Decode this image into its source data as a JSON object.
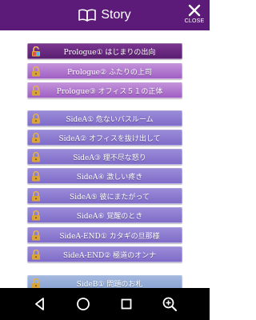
{
  "header": {
    "title": "Story",
    "close_label": "CLOSE",
    "background": "#5c1b78",
    "icons": {
      "title": "open-book-icon",
      "close": "close-icon"
    }
  },
  "chapters": [
    {
      "label": "Prologue① はじまりの出向",
      "group": "prologue",
      "state": "current",
      "icon": "unlocked-padlock-icon"
    },
    {
      "label": "Prologue② ふたりの上司",
      "group": "prologue",
      "state": "locked",
      "icon": "padlock-icon"
    },
    {
      "label": "Prologue③ オフィス５１の正体",
      "group": "prologue",
      "state": "locked",
      "icon": "padlock-icon"
    },
    {
      "label": "SideA① 危ないバスルーム",
      "group": "sidea",
      "state": "locked",
      "icon": "padlock-icon"
    },
    {
      "label": "SideA② オフィスを抜け出して",
      "group": "sidea",
      "state": "locked",
      "icon": "padlock-icon"
    },
    {
      "label": "SideA③ 理不尽な怒り",
      "group": "sidea",
      "state": "locked",
      "icon": "padlock-icon"
    },
    {
      "label": "SideA④ 激しい疼き",
      "group": "sidea",
      "state": "locked",
      "icon": "padlock-icon"
    },
    {
      "label": "SideA⑤ 彼にまたがって",
      "group": "sidea",
      "state": "locked",
      "icon": "padlock-icon"
    },
    {
      "label": "SideA⑥ 覚醒のとき",
      "group": "sidea",
      "state": "locked",
      "icon": "padlock-icon"
    },
    {
      "label": "SideA-END① カタギの旦那様",
      "group": "sidea",
      "state": "locked",
      "icon": "padlock-icon"
    },
    {
      "label": "SideA-END② 極道のオンナ",
      "group": "sidea",
      "state": "locked",
      "icon": "padlock-icon"
    },
    {
      "label": "SideB① 問題のお札",
      "group": "sideb",
      "state": "locked",
      "icon": "padlock-icon"
    }
  ],
  "navbar": {
    "buttons": [
      "back-triangle-icon",
      "home-circle-icon",
      "recents-square-icon",
      "zoom-in-icon"
    ]
  },
  "colors": {
    "prologue_current": "#5a1f70",
    "prologue": "#b07ad0",
    "sidea": "#8a78cf",
    "sideb": "#95acd8",
    "navbar": "#000000"
  }
}
